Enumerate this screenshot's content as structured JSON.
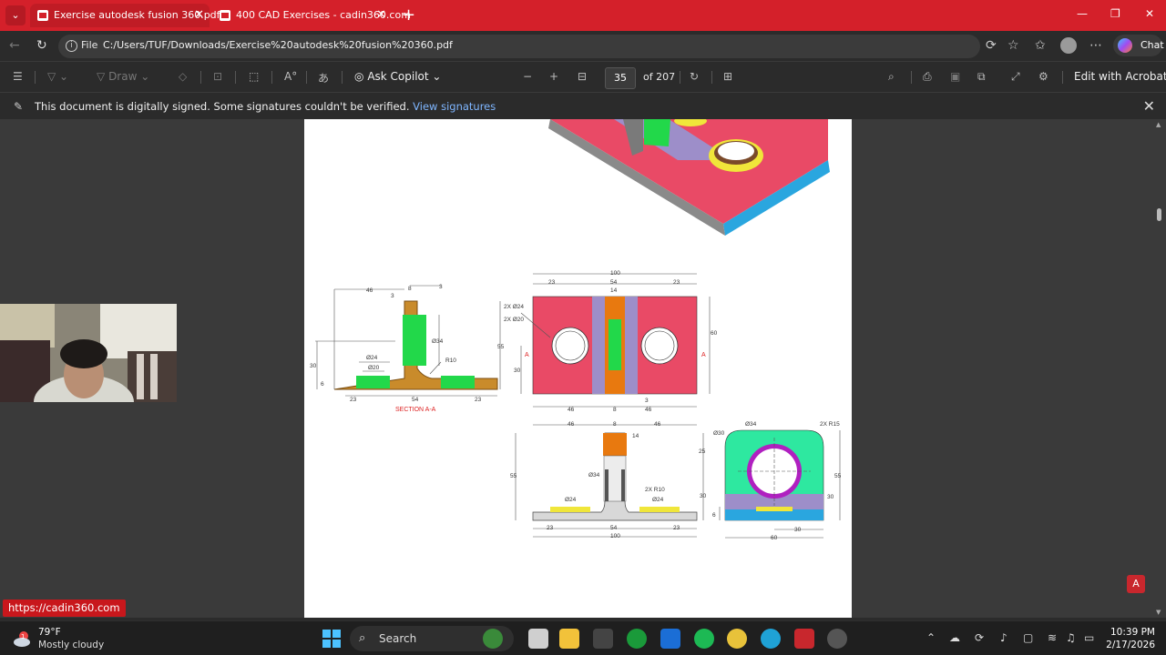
{
  "browser": {
    "tabs": [
      {
        "title": "Exercise autodesk fusion 360.pdf",
        "active": true
      },
      {
        "title": "400 CAD Exercises - cadin360.com",
        "active": false
      }
    ],
    "address": {
      "scheme_label": "File",
      "url": "C:/Users/TUF/Downloads/Exercise%20autodesk%20fusion%20360.pdf"
    },
    "chat_label": "Chat"
  },
  "pdf_toolbar": {
    "draw_label": "Draw",
    "copilot_label": "Ask Copilot",
    "page_current": "35",
    "page_total": "of 207",
    "edit_acrobat": "Edit with Acrobat"
  },
  "infobar": {
    "message": "This document is digitally signed. Some signatures couldn't be verified.",
    "link": "View signatures"
  },
  "drawing": {
    "section_label": "SECTION A-A",
    "section_marker": "A",
    "dims": {
      "d46": "46",
      "d8": "8",
      "d3": "3",
      "d54": "54",
      "d23": "23",
      "d100": "100",
      "d14": "14",
      "d55": "55",
      "d60": "60",
      "d30": "30",
      "d25": "25",
      "d6": "6",
      "phi24": "Ø24",
      "phi20": "Ø20",
      "phi34": "Ø34",
      "phi30": "Ø30",
      "r10": "R10",
      "two_phi24": "2X Ø24",
      "two_phi20": "2X Ø20",
      "two_r10": "2X R10",
      "two_r15": "2X R15"
    }
  },
  "status_url": "https://cadin360.com",
  "taskbar": {
    "temperature": "79°F",
    "weather_text": "Mostly cloudy",
    "weather_badge": "1",
    "search_label": "Search",
    "time": "10:39 PM",
    "date": "2/17/2026"
  },
  "colors": {
    "tabbar": "#d4202a",
    "accent_red": "#c8171c",
    "part_pink": "#e94a66",
    "part_green": "#22d84a",
    "part_purple": "#9d8ec9",
    "part_orange": "#e8790f",
    "part_cyan": "#2aa6df",
    "part_yellow": "#f0e63a"
  },
  "icons": [
    "chevron-down-icon",
    "pdf-icon",
    "close-icon",
    "plus-icon",
    "back-icon",
    "refresh-icon",
    "info-icon",
    "read-aloud-icon",
    "favorite-icon",
    "collections-icon",
    "more-icon",
    "contents-icon",
    "highlight-icon",
    "draw-icon",
    "erase-icon",
    "text-icon",
    "translate-icon",
    "copilot-icon",
    "minus-icon",
    "fit-icon",
    "rotate-icon",
    "page-view-icon",
    "search-icon",
    "print-icon",
    "save-icon",
    "save-as-icon",
    "fullscreen-icon",
    "settings-icon",
    "pen-icon",
    "windows-icon",
    "adobe-icon"
  ]
}
